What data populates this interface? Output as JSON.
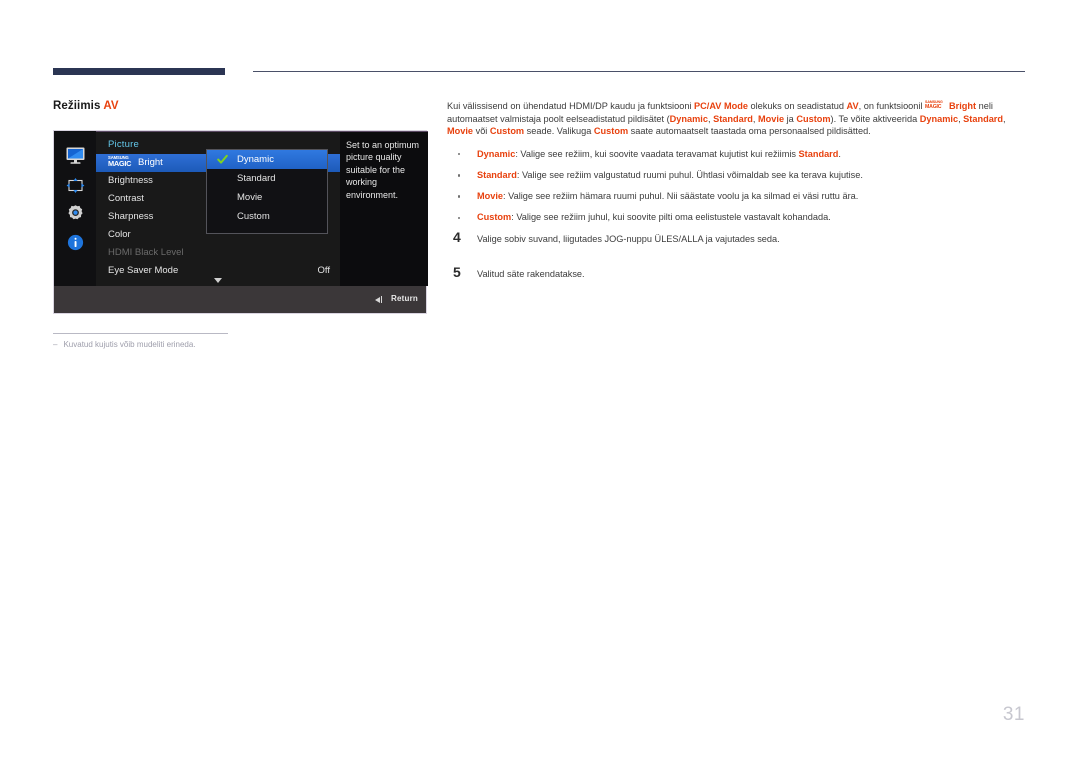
{
  "document": {
    "page_number": "31",
    "section_heading_main": "Režiimis",
    "section_heading_accent": "AV"
  },
  "osd": {
    "title": "Picture",
    "rail_icons": [
      {
        "name": "monitor-icon",
        "label": "Picture"
      },
      {
        "name": "resize-arrows-icon",
        "label": "OnScreen Display"
      },
      {
        "name": "gear-icon",
        "label": "System"
      },
      {
        "name": "info-icon",
        "label": "Information"
      }
    ],
    "menu_items": [
      {
        "label": "Bright",
        "prefix_logo": "samsung-magic",
        "value": "",
        "state": "selected"
      },
      {
        "label": "Brightness",
        "value": "",
        "state": "normal"
      },
      {
        "label": "Contrast",
        "value": "",
        "state": "normal"
      },
      {
        "label": "Sharpness",
        "value": "",
        "state": "normal"
      },
      {
        "label": "Color",
        "value": "",
        "state": "normal"
      },
      {
        "label": "HDMI Black Level",
        "value": "",
        "state": "disabled"
      },
      {
        "label": "Eye Saver Mode",
        "value": "Off",
        "state": "normal"
      }
    ],
    "logo": {
      "line1": "SAMSUNG",
      "line2": "MAGIC"
    },
    "submenu": {
      "options": [
        {
          "label": "Dynamic",
          "selected": true
        },
        {
          "label": "Standard",
          "selected": false
        },
        {
          "label": "Movie",
          "selected": false
        },
        {
          "label": "Custom",
          "selected": false
        }
      ]
    },
    "description": "Set to an optimum picture quality suitable for the working environment.",
    "bottom_bar": {
      "return_label": "Return"
    },
    "colors": {
      "title_blue": "#63c6e8",
      "highlight_blue": "#2f6fd6",
      "check_green": "#7ed321",
      "panel_dark": "#191919"
    }
  },
  "footnote": {
    "dash": "‒",
    "text": "Kuvatud kujutis võib mudeliti erineda."
  },
  "content": {
    "paragraph": {
      "p1": "Kui välissisend on ühendatud HDMI/DP kaudu ja funktsiooni ",
      "b1": "PC/AV Mode",
      "p2": " olekuks on seadistatud ",
      "b2": "AV",
      "p3": ", on funktsioonil ",
      "logo1": "SAMSUNG",
      "logo2": "MAGIC",
      "b3": "Bright",
      "p4": " neli automaatset valmistaja poolt eelseadistatud pildisätet (",
      "b4": "Dynamic",
      "p5": ", ",
      "b5": "Standard",
      "p6": ", ",
      "b6": "Movie",
      "p7": " ja ",
      "b7": "Custom",
      "p8": "). Te võite aktiveerida ",
      "b8": "Dynamic",
      "p9": ", ",
      "b9": "Standard",
      "p10": ", ",
      "b10": "Movie",
      "p11": " või ",
      "b11": "Custom",
      "p12": " seade. Valikuga ",
      "b12": "Custom",
      "p13": " saate automaatselt taastada oma personaalsed pildisätted."
    },
    "bullets": [
      {
        "term": "Dynamic",
        "sep": ": ",
        "text_before": "Valige see režiim, kui soovite vaadata teravamat kujutist kui režiimis ",
        "term2": "Standard",
        "text_after": "."
      },
      {
        "term": "Standard",
        "sep": ": ",
        "text_before": "Valige see režiim valgustatud ruumi puhul. Ühtlasi võimaldab see ka terava kujutise.",
        "term2": "",
        "text_after": ""
      },
      {
        "term": "Movie",
        "sep": ": ",
        "text_before": "Valige see režiim hämara ruumi puhul. Nii säästate voolu ja ka silmad ei väsi ruttu ära.",
        "term2": "",
        "text_after": ""
      },
      {
        "term": "Custom",
        "sep": ": ",
        "text_before": "Valige see režiim juhul, kui soovite pilti oma eelistustele vastavalt kohandada.",
        "term2": "",
        "text_after": ""
      }
    ],
    "steps": [
      {
        "number": "4",
        "text": "Valige sobiv suvand, liigutades JOG-nuppu ÜLES/ALLA ja vajutades seda."
      },
      {
        "number": "5",
        "text": "Valitud säte rakendatakse."
      }
    ]
  }
}
